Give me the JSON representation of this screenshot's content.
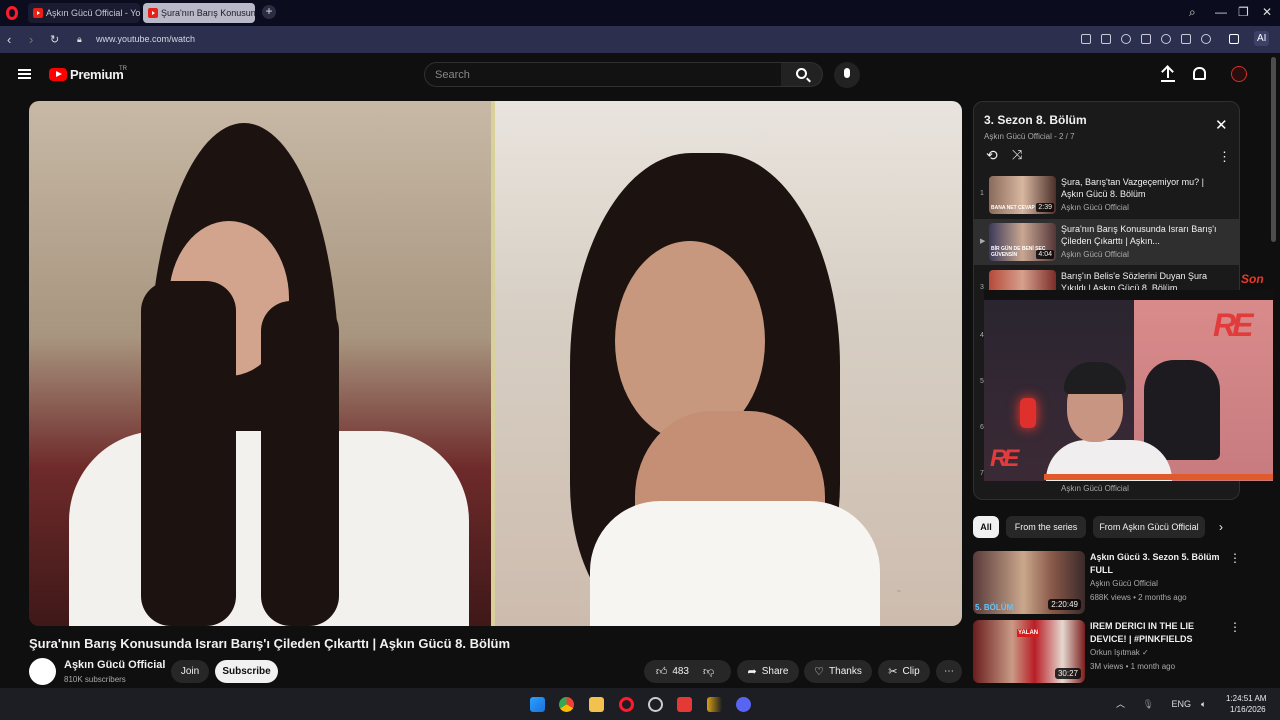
{
  "browser": {
    "tabs": [
      {
        "label": "Aşkın Gücü Official - YouT"
      },
      {
        "label": "Şura'nın Barış Konusunda"
      }
    ],
    "url": "www.youtube.com/watch",
    "ai_label": "AI"
  },
  "header": {
    "brand": "Premium",
    "country": "TR",
    "search_placeholder": "Search"
  },
  "video": {
    "title": "Şura'nın Barış Konusunda Israrı Barış'ı Çileden Çıkarttı | Aşkın Gücü 8. Bölüm",
    "channel": "Aşkın Gücü Official",
    "subscribers": "810K subscribers",
    "join_label": "Join",
    "subscribe_label": "Subscribe",
    "likes": "483",
    "share_label": "Share",
    "thanks_label": "Thanks",
    "clip_label": "Clip"
  },
  "playlist": {
    "title": "3. Sezon 8. Bölüm",
    "subtitle": "Aşkın Gücü Official - 2 / 7",
    "items": [
      {
        "index": "1",
        "title": "Şura, Barış'tan Vazgeçemiyor mu? | Aşkın Gücü 8. Bölüm",
        "channel": "Aşkın Gücü Official",
        "duration": "2:39",
        "thumb_text": "BANA NET CEVAP"
      },
      {
        "index": "▶",
        "title": "Şura'nın Barış Konusunda Israrı Barış'ı Çileden Çıkarttı | Aşkın...",
        "channel": "Aşkın Gücü Official",
        "duration": "4:04",
        "thumb_text": "BİR GÜN DE BENİ SEÇ GÜVENSİN"
      },
      {
        "index": "3",
        "title": "Barış'ın Belis'e Sözlerini Duyan Şura Yıkıldı | Aşkın Gücü 8. Bölüm",
        "channel": "Aşkın Gücü Official",
        "duration": "",
        "thumb_text": ""
      }
    ],
    "hidden_indices": [
      "4",
      "5",
      "6",
      "7"
    ],
    "last_channel": "Aşkın Gücü Official"
  },
  "overlay": {
    "son_badge": "Son",
    "logo_text": "RE"
  },
  "chips": [
    "All",
    "From the series",
    "From Aşkın Gücü Official"
  ],
  "recommendations": [
    {
      "title": "Aşkın Gücü 3. Sezon 5. Bölüm FULL",
      "channel": "Aşkın Gücü Official",
      "meta": "688K views • 2 months ago",
      "duration": "2:20:49",
      "thumb_text": "5. BÖLÜM"
    },
    {
      "title": "IREM DERICI IN THE LIE DEVICE! | #PINKFIELDS",
      "channel": "Orkun Işıtmak ✓",
      "meta": "3M views • 1 month ago",
      "duration": "30:27",
      "thumb_text": "YALAN"
    }
  ],
  "taskbar": {
    "lang": "ENG",
    "time": "1:24:51 AM",
    "date": "1/16/2026"
  },
  "colors": {
    "accent_red": "#ff0000",
    "background": "#0f0f0f",
    "tab_active": "#b8b8c8"
  }
}
